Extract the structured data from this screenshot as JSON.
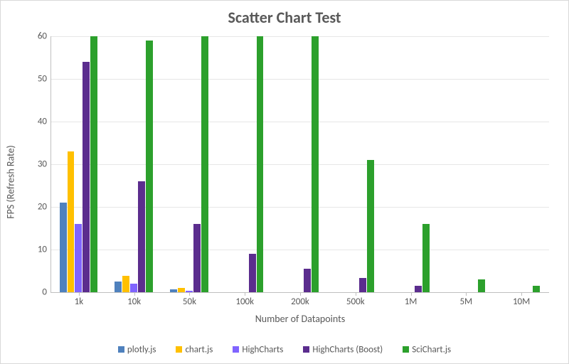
{
  "chart_data": {
    "type": "bar",
    "title": "Scatter Chart Test",
    "xlabel": "Number of Datapoints",
    "ylabel": "FPS (Refresh Rate)",
    "ylim": [
      0,
      60
    ],
    "y_ticks": [
      0,
      10,
      20,
      30,
      40,
      50,
      60
    ],
    "categories": [
      "1k",
      "10k",
      "50k",
      "100k",
      "200k",
      "500k",
      "1M",
      "5M",
      "10M"
    ],
    "series": [
      {
        "name": "plotly.js",
        "color": "#4f81bd",
        "values": [
          21,
          2.5,
          0.6,
          0,
          0,
          0,
          0,
          0,
          0
        ]
      },
      {
        "name": "chart.js",
        "color": "#ffc000",
        "values": [
          33,
          3.8,
          1.0,
          0,
          0,
          0,
          0,
          0,
          0
        ]
      },
      {
        "name": "HighCharts",
        "color": "#8064ff",
        "values": [
          16,
          2.0,
          0.3,
          0,
          0,
          0,
          0,
          0,
          0
        ]
      },
      {
        "name": "HighCharts (Boost)",
        "color": "#5b2d8e",
        "values": [
          54,
          26,
          16,
          9,
          5.5,
          3.3,
          1.5,
          0,
          0
        ]
      },
      {
        "name": "SciChart.js",
        "color": "#2ca02c",
        "values": [
          60,
          59,
          60,
          60,
          60,
          31,
          16,
          3,
          1.5
        ]
      }
    ],
    "legend_position": "bottom",
    "grid": true
  }
}
